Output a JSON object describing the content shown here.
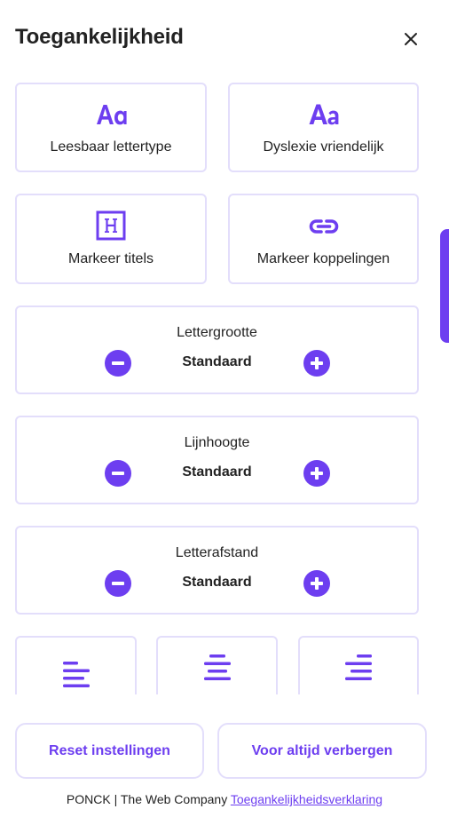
{
  "header": {
    "title": "Toegankelijkheid",
    "close_icon": "close-icon"
  },
  "tiles": [
    {
      "label": "Leesbaar lettertype",
      "icon": "readable-font-icon"
    },
    {
      "label": "Dyslexie vriendelijk",
      "icon": "dyslexia-font-icon"
    },
    {
      "label": "Markeer titels",
      "icon": "heading-icon"
    },
    {
      "label": "Markeer koppelingen",
      "icon": "link-icon"
    }
  ],
  "steppers": [
    {
      "label": "Lettergrootte",
      "value": "Standaard"
    },
    {
      "label": "Lijnhoogte",
      "value": "Standaard"
    },
    {
      "label": "Letterafstand",
      "value": "Standaard"
    }
  ],
  "align_tiles": [
    {
      "icon": "align-left-icon"
    },
    {
      "icon": "align-center-icon"
    },
    {
      "icon": "align-right-icon"
    }
  ],
  "buttons": {
    "reset": "Reset instellingen",
    "hide": "Voor altijd verbergen"
  },
  "footer": {
    "company": "PONCK | The Web Company",
    "link": "Toegankelijkheidsverklaring"
  },
  "colors": {
    "accent": "#6d3ef0",
    "border": "#e3defb",
    "text": "#222222"
  }
}
